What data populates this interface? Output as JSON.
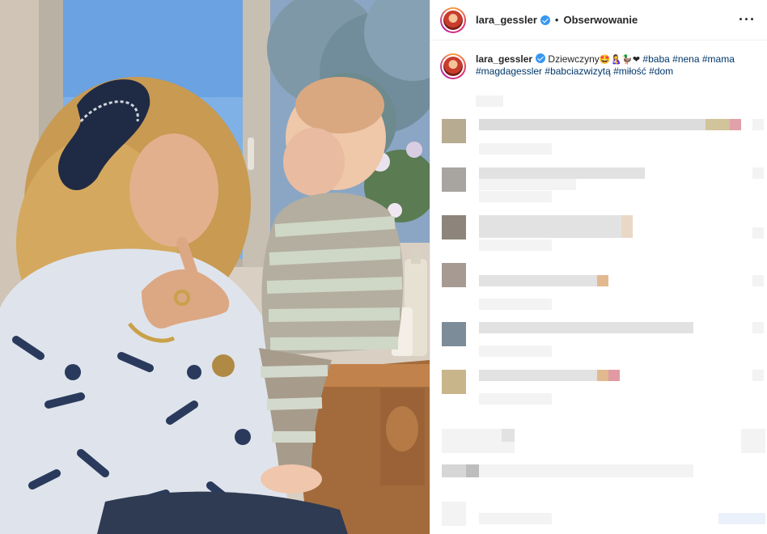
{
  "post": {
    "username": "lara_gessler",
    "separator": "•",
    "follow_label": "Obserwowanie",
    "more_label": "···",
    "caption": {
      "username": "lara_gessler",
      "text": "Dziewczyny",
      "emojis": "🤩🤱🦆❤",
      "hashtags": [
        "#baba",
        "#nena",
        "#mama",
        "#magdagessler",
        "#babciazwizytą",
        "#miłość",
        "#dom"
      ]
    }
  },
  "colors": {
    "verified": "#3897f0",
    "hashtag": "#00376b",
    "avatar_ring": [
      "#f9a13a",
      "#e0306a",
      "#b628a4"
    ]
  },
  "icons": [
    "verified-badge-icon",
    "more-options-icon"
  ]
}
